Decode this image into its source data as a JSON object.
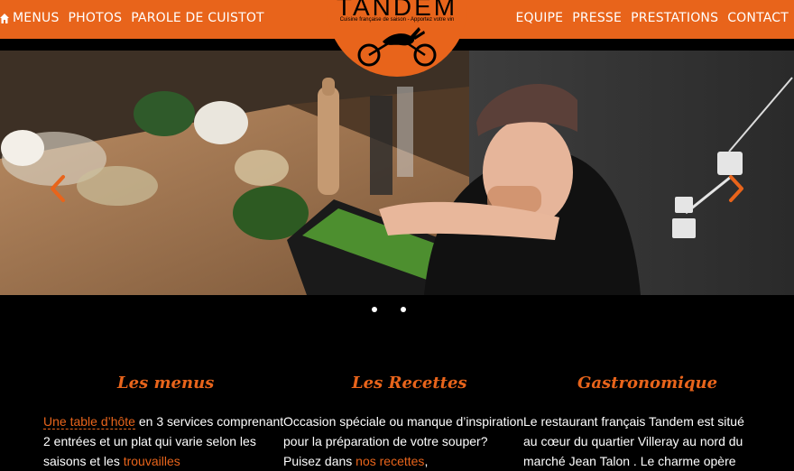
{
  "nav": {
    "left": [
      "MENUS",
      "PHOTOS",
      "PAROLE DE CUISTOT"
    ],
    "right": [
      "EQUIPE",
      "PRESSE",
      "PRESTATIONS",
      "CONTACT"
    ]
  },
  "logo": {
    "title": "TANDEM",
    "tagline": "Cuisine française de saison - Apportez votre vin"
  },
  "colors": {
    "brand_orange": "#E8641B",
    "background": "#000000",
    "text": "#FFFFFF"
  },
  "icons": {
    "home": "home-icon",
    "prev": "chevron-left-icon",
    "next": "chevron-right-icon"
  },
  "slider": {
    "count": 2
  },
  "columns": [
    {
      "title": "Les menus",
      "link1": "Une table d’hôte",
      "text1": " en 3 services comprenant 2 entrées et un plat qui varie selon les saisons et les ",
      "link2": "trouvailles"
    },
    {
      "title": "Les Recettes",
      "text1": "Occasion spéciale ou manque d’inspiration pour la préparation de votre souper? Puisez dans ",
      "link1": "nos recettes",
      "text2": ","
    },
    {
      "title": "Gastronomique",
      "text1": "Le restaurant français Tandem est situé au cœur du quartier Villeray au nord du marché Jean Talon . Le charme opère"
    }
  ]
}
